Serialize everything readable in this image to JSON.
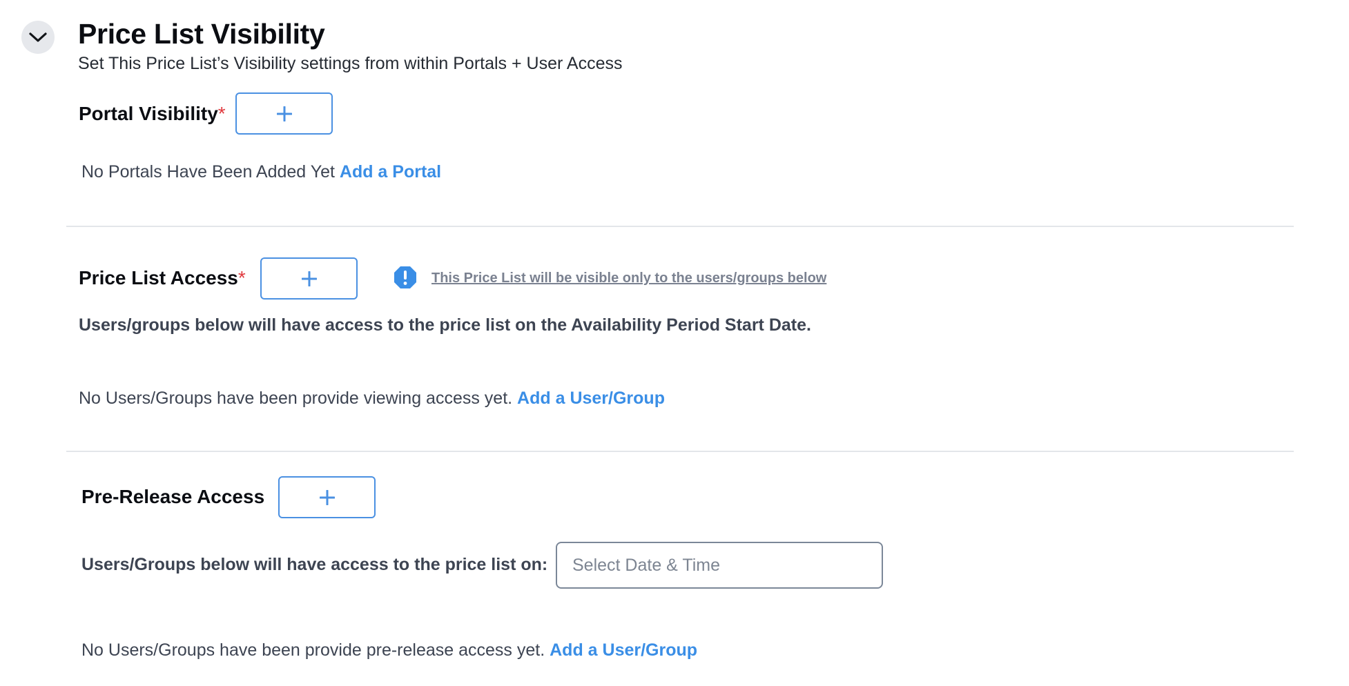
{
  "section": {
    "title": "Price List Visibility",
    "subtitle": "Set This Price List’s Visibility settings from within Portals + User Access"
  },
  "portal_visibility": {
    "label": "Portal Visibility",
    "required_marker": "*",
    "empty_text": "No Portals Have Been Added Yet",
    "add_link": "Add a Portal"
  },
  "price_list_access": {
    "label": "Price List Access",
    "required_marker": "*",
    "info_text": "This Price List will be visible only to the users/groups below",
    "description": "Users/groups below will have access to the price list on the Availability Period Start Date.",
    "empty_text": "No Users/Groups have been provide viewing access yet.",
    "add_link": "Add a User/Group"
  },
  "pre_release_access": {
    "label": "Pre-Release Access",
    "date_label": "Users/Groups below will have access to the price list on:",
    "date_placeholder": "Select Date & Time",
    "empty_text": "No Users/Groups have been provide pre-release access yet.",
    "add_link": "Add a User/Group"
  },
  "colors": {
    "accent": "#4a90e2",
    "link": "#3a8ee6",
    "required": "#e0393e",
    "divider": "#e3e6ea"
  },
  "icons": {
    "collapse": "chevron-down-icon",
    "add": "plus-icon",
    "info": "exclamation-octagon-icon"
  }
}
